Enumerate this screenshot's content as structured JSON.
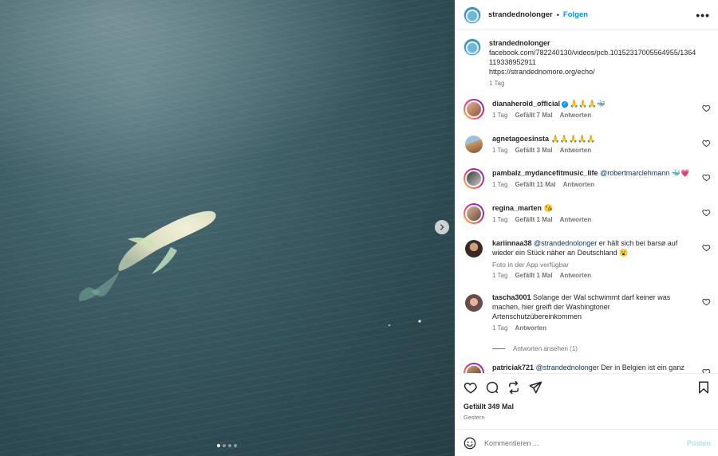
{
  "post": {
    "username": "strandednolonger",
    "separator": "•",
    "follow_label": "Folgen",
    "more_glyph": "•••",
    "caption_lines": [
      "facebook.com/782240130/videos/pcb.10152317005564955/1364",
      "119338952911",
      "https://strandednomore.org/echo/"
    ],
    "caption_time": "1 Tag",
    "likes": "Gefällt 349 Mal",
    "date": "Gestern",
    "media_slides": 4,
    "media_active_slide": 1
  },
  "comments": [
    {
      "user": "dianaherold_official",
      "verified": true,
      "text": "🙏🙏🙏🐳",
      "time": "1 Tag",
      "likes": "Gefällt 7 Mal",
      "reply": "Antworten"
    },
    {
      "user": "agnetagoesinsta",
      "text": "🙏🙏🙏🙏🙏",
      "time": "1 Tag",
      "likes": "Gefällt 3 Mal",
      "reply": "Antworten"
    },
    {
      "user": "pambalz_mydancefitmusic_life",
      "mention": "@robertmarclehmann",
      "text": "🐳💗",
      "time": "1 Tag",
      "likes": "Gefällt 11 Mal",
      "reply": "Antworten"
    },
    {
      "user": "regina_marten",
      "text": "😘",
      "time": "1 Tag",
      "likes": "Gefällt 1 Mal",
      "reply": "Antworten"
    },
    {
      "user": "kariinnaa38",
      "mention": "@strandednolonger",
      "text_line1": " er hält sich bei barsø auf",
      "text_line2": "wieder ein Stück näher an Deutschland 😮",
      "note": "Foto in der App verfügbar",
      "time": "1 Tag",
      "likes": "Gefällt 1 Mal",
      "reply": "Antworten"
    },
    {
      "user": "tascha3001",
      "text_line1": " Solange der Wal schwimmt darf keiner was",
      "text_line2": "machen, hier greift der Washingtoner",
      "text_line3": "Artenschutzübereinkommen",
      "time": "1 Tag",
      "reply": "Antworten"
    },
    {
      "user": "patriciak721",
      "mention": "@strandednolonger",
      "text": " Der in Belgien ist ein ganz"
    }
  ],
  "view_replies": "Antworten ansehen (1)",
  "composer": {
    "placeholder": "Kommentieren ...",
    "post_label": "Posten"
  },
  "colors": {
    "accent": "#0095f6",
    "post_disabled": "#b2dffc",
    "muted": "#737373"
  },
  "icons": [
    "ellipsis-icon",
    "heart-icon",
    "comment-icon",
    "repost-icon",
    "share-icon",
    "bookmark-icon",
    "emoji-icon",
    "chevron-right-icon"
  ]
}
